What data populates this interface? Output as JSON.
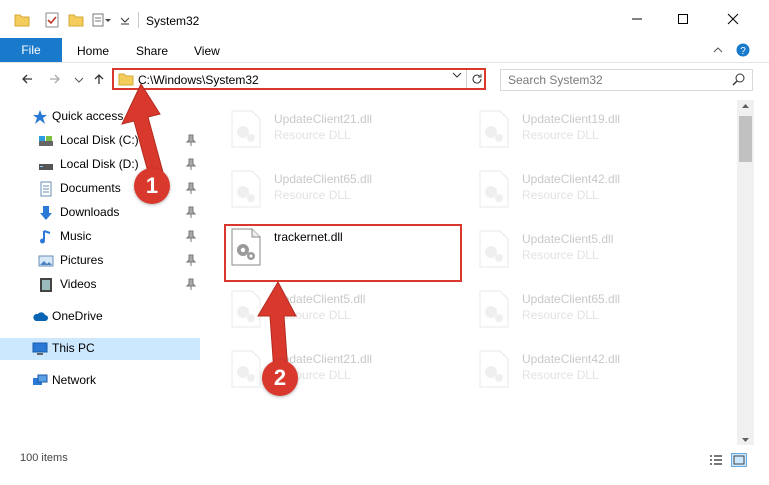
{
  "window": {
    "title": "System32",
    "controls": [
      "minimize",
      "maximize",
      "close"
    ]
  },
  "ribbon": {
    "file_tab": "File",
    "tabs": [
      "Home",
      "Share",
      "View"
    ]
  },
  "address": {
    "path": "C:\\Windows\\System32",
    "search_placeholder": "Search System32"
  },
  "sidebar": {
    "items": [
      {
        "label": "Quick access",
        "icon": "star-icon"
      },
      {
        "label": "Local Disk (C:)",
        "icon": "drive-icon",
        "pinned": true
      },
      {
        "label": "Local Disk (D:)",
        "icon": "drive-icon",
        "pinned": true
      },
      {
        "label": "Documents",
        "icon": "documents-icon",
        "pinned": true
      },
      {
        "label": "Downloads",
        "icon": "downloads-icon",
        "pinned": true
      },
      {
        "label": "Music",
        "icon": "music-icon",
        "pinned": true
      },
      {
        "label": "Pictures",
        "icon": "pictures-icon",
        "pinned": true
      },
      {
        "label": "Videos",
        "icon": "videos-icon",
        "pinned": true
      },
      {
        "label": "OneDrive",
        "icon": "cloud-icon"
      },
      {
        "label": "This PC",
        "icon": "computer-icon",
        "selected": true
      },
      {
        "label": "Network",
        "icon": "network-icon"
      }
    ]
  },
  "files": [
    {
      "name": "UpdateClient21.dll",
      "type": "Resource DLL"
    },
    {
      "name": "UpdateClient19.dll",
      "type": "Resource DLL"
    },
    {
      "name": "UpdateClient65.dll",
      "type": "Resource DLL"
    },
    {
      "name": "UpdateClient42.dll",
      "type": "Resource DLL"
    },
    {
      "name": "trackernet.dll",
      "type": ""
    },
    {
      "name": "UpdateClient5.dll",
      "type": "Resource DLL"
    },
    {
      "name": "UpdateClient5.dll",
      "type": "Resource DLL"
    },
    {
      "name": "UpdateClient65.dll",
      "type": "Resource DLL"
    },
    {
      "name": "UpdateClient21.dll",
      "type": "Resource DLL"
    },
    {
      "name": "UpdateClient42.dll",
      "type": "Resource DLL"
    }
  ],
  "status": {
    "item_count": "100 items"
  },
  "annotations": {
    "step1": "1",
    "step2": "2"
  },
  "colors": {
    "accent": "#1979ca",
    "highlight": "#d9382d",
    "selected_bg": "#cce8ff"
  }
}
